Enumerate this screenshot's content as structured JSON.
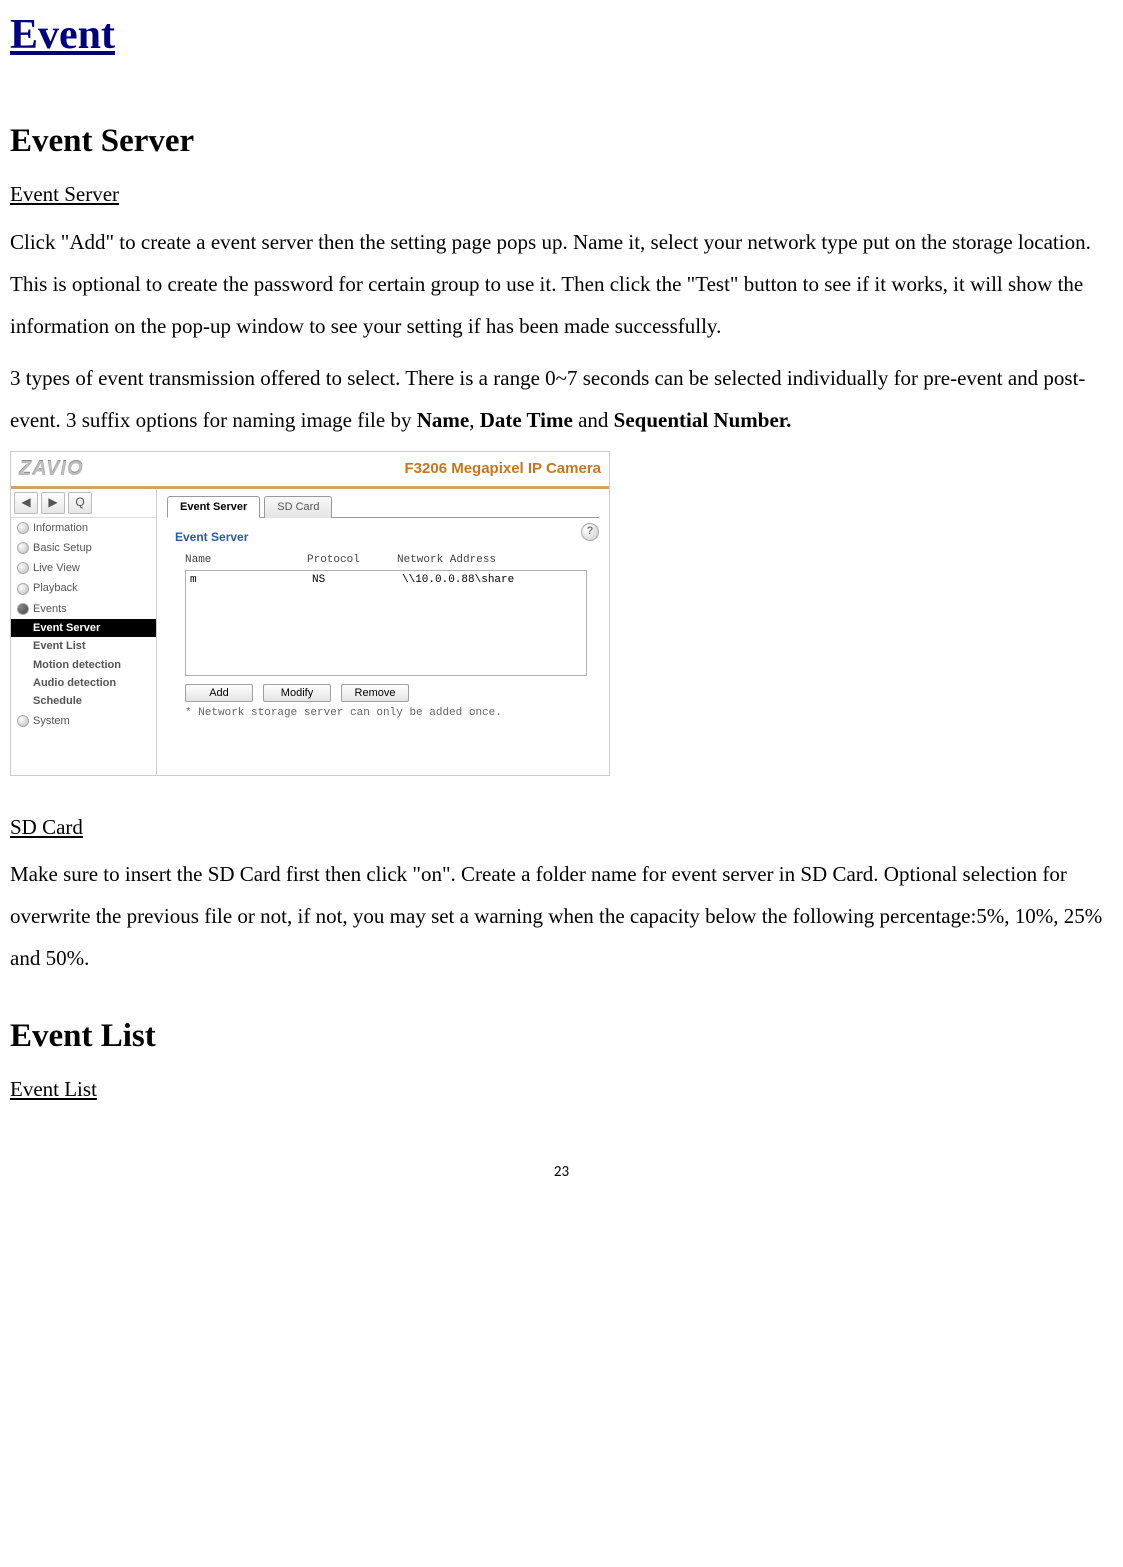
{
  "section_title": "Event",
  "eventServer": {
    "title": "Event Server",
    "subhead": "Event Server",
    "p1_a": "Click \"Add\" to create a event server then the setting page pops up. Name it, select your network type put on the storage location. This is optional to create the password for certain group to use it. Then click the \"Test\" button to see if it works, it will show the information on the pop-up window to see your setting if has been made successfully.",
    "p2_pre": "3 types of event transmission offered to select. There is a range 0~7 seconds can be selected individually for pre-event and post-event. 3 suffix options for naming image file by ",
    "p2_strong1": "Name",
    "p2_sep1": ", ",
    "p2_strong2": "Date Time",
    "p2_sep2": " and ",
    "p2_strong3": "Sequential Number."
  },
  "shot": {
    "logo": "ZAVIO",
    "product": "F3206 Megapixel IP Camera",
    "toolbar": {
      "t1": "◀",
      "t2": "▶",
      "t3": "Q"
    },
    "sidebar": {
      "information": "Information",
      "basic": "Basic Setup",
      "live": "Live View",
      "playback": "Playback",
      "events": "Events",
      "sub": {
        "server": "Event Server",
        "list": "Event List",
        "motion": "Motion detection",
        "audio": "Audio detection",
        "schedule": "Schedule"
      },
      "system": "System"
    },
    "tabs": {
      "server": "Event Server",
      "sd": "SD Card"
    },
    "panel_title": "Event Server",
    "help": "?",
    "headers": {
      "name": "Name",
      "protocol": "Protocol",
      "addr": "Network Address"
    },
    "row": {
      "name": "m",
      "protocol": "NS",
      "addr": "\\\\10.0.0.88\\share"
    },
    "buttons": {
      "add": "Add",
      "modify": "Modify",
      "remove": "Remove"
    },
    "note": "Network storage server can only be added once."
  },
  "sdCard": {
    "subhead": "SD Card",
    "p": "Make sure to insert the SD Card first then click \"on\". Create a folder name for event server in SD Card. Optional selection for overwrite the previous file or not, if not, you may set a warning when the capacity below the following percentage:5%, 10%, 25% and 50%."
  },
  "eventList": {
    "title": "Event List",
    "subhead": "Event List"
  },
  "pageNumber": "23"
}
